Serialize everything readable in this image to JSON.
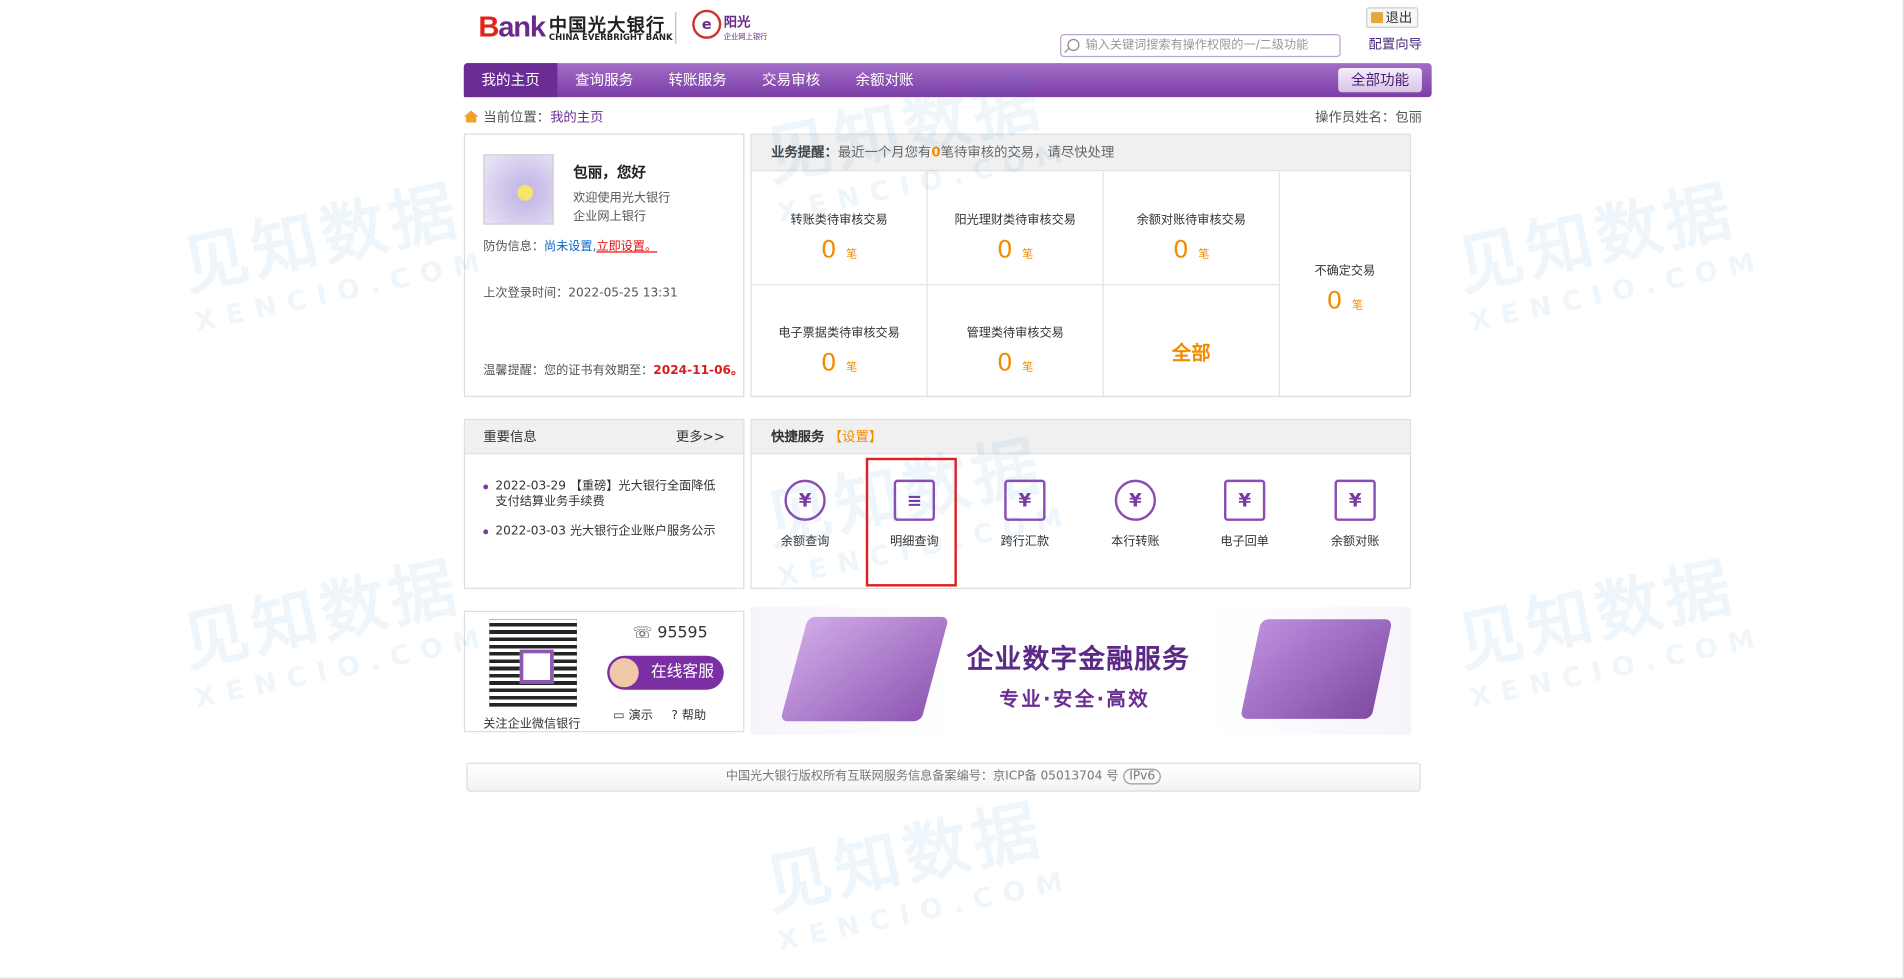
{
  "header": {
    "bank_logo": "Bank",
    "bank_name_cn": "中国光大银行",
    "bank_name_en": "CHINA EVERBRIGHT BANK",
    "sub_brand": "阳光",
    "sub_brand_caption": "企业网上银行",
    "search_placeholder": "输入关键词搜索有操作权限的一/二级功能",
    "logout_label": "退出",
    "config_label": "配置向导"
  },
  "nav": {
    "items": [
      "我的主页",
      "查询服务",
      "转账服务",
      "交易审核",
      "余额对账"
    ],
    "all_functions": "全部功能"
  },
  "breadcrumb": {
    "prefix": "当前位置：",
    "current": "我的主页"
  },
  "operator": "操作员姓名：包丽",
  "user": {
    "greeting": "包丽，您好",
    "welcome_line1": "欢迎使用光大银行",
    "welcome_line2": "企业网上银行",
    "antifraud_label": "防伪信息：",
    "antifraud_status": "尚未设置,",
    "antifraud_action": "立即设置。",
    "last_login": "上次登录时间：2022-05-25 13:31",
    "cert_tip": "温馨提醒：您的证书有效期至：",
    "cert_date": "2024-11-06。"
  },
  "reminder": {
    "label": "业务提醒：",
    "text_pre": "最近一个月您有",
    "count": "0",
    "text_post": "笔待审核的交易，请尽快处理",
    "unit": "笔",
    "cells": [
      {
        "label": "转账类待审核交易",
        "count": "0"
      },
      {
        "label": "阳光理财类待审核交易",
        "count": "0"
      },
      {
        "label": "余额对账待审核交易",
        "count": "0"
      },
      {
        "label": "电子票据类待审核交易",
        "count": "0"
      },
      {
        "label": "管理类待审核交易",
        "count": "0"
      }
    ],
    "uncertain_label": "不确定交易",
    "uncertain_count": "0",
    "all_label": "全部"
  },
  "news": {
    "title": "重要信息",
    "more": "更多>>",
    "items": [
      "2022-03-29 【重磅】光大银行全面降低支付结算业务手续费",
      "2022-03-03 光大银行企业账户服务公示"
    ]
  },
  "quick": {
    "title": "快捷服务",
    "settings": "【设置】",
    "items": [
      {
        "label": "余额查询",
        "icon": "balance-query-icon",
        "glyph": "¥"
      },
      {
        "label": "明细查询",
        "icon": "detail-query-icon",
        "glyph": "≡"
      },
      {
        "label": "跨行汇款",
        "icon": "interbank-remit-icon",
        "glyph": "¥"
      },
      {
        "label": "本行转账",
        "icon": "intrabank-transfer-icon",
        "glyph": "¥"
      },
      {
        "label": "电子回单",
        "icon": "e-receipt-icon",
        "glyph": "¥"
      },
      {
        "label": "余额对账",
        "icon": "balance-reconcile-icon",
        "glyph": "¥"
      }
    ]
  },
  "contact": {
    "qr_label": "关注企业微信银行",
    "phone": "95595",
    "online_service": "在线客服",
    "demo": "演示",
    "help": "帮助"
  },
  "banner": {
    "title": "企业数字金融服务",
    "subtitle": "专业·安全·高效"
  },
  "footer": {
    "text": "中国光大银行版权所有互联网服务信息备案编号：京ICP备 05013704 号",
    "badge": "IPv6"
  },
  "watermark": {
    "cn": "见知数据",
    "en": "XENCIO.COM"
  },
  "colors": {
    "brand_purple": "#7b3da6",
    "accent_orange": "#f08c00",
    "alert_red": "#e01010"
  }
}
